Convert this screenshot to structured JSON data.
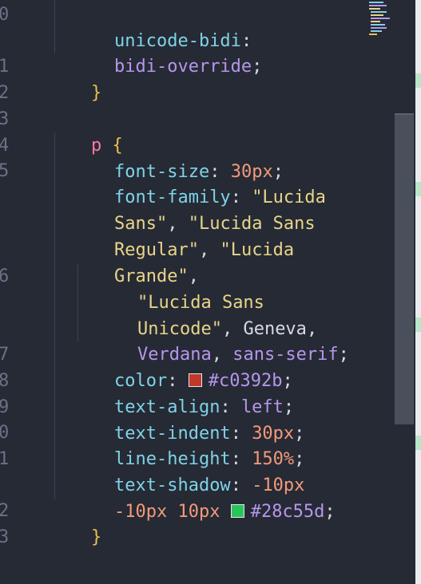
{
  "editor": {
    "gutter_numbers": [
      "0",
      "1",
      "2",
      "3",
      "4",
      "5",
      "6",
      "7",
      "8",
      "9",
      "0",
      "1",
      "2",
      "3"
    ],
    "colors": {
      "background": "#262a35",
      "property": "#7fd3e6",
      "string": "#e8d589",
      "keyword": "#b696ec",
      "number": "#f29a7a",
      "selector": "#f97b9d",
      "brace": "#e8c14a"
    },
    "code": {
      "l1_prop": "unicode-bidi",
      "l1_colon": ":",
      "l2_val": "bidi-override",
      "l2_semi": ";",
      "l3_brace": "}",
      "l5_sel": "p",
      "l5_brace": "{",
      "l6_prop": "font-size",
      "l6_colon": ": ",
      "l6_num": "30px",
      "l6_semi": ";",
      "l7_prop": "font-family",
      "l7_colon": ": ",
      "l7_str": "\"Lucida",
      "l8_str1": "Sans\"",
      "l8_comma": ", ",
      "l8_str2": "\"Lucida Sans",
      "l9_str1": "Regular\"",
      "l9_comma": ", ",
      "l9_str2": "\"Lucida",
      "l10_str": "Grande\"",
      "l10_comma": ",",
      "l11_str": "\"Lucida Sans",
      "l12_str": "Unicode\"",
      "l12_comma": ", ",
      "l12_val": "Geneva",
      "l12_comma2": ",",
      "l13_val1": "Verdana",
      "l13_comma": ", ",
      "l13_val2": "sans-serif",
      "l13_semi": ";",
      "l14_prop": "color",
      "l14_colon": ": ",
      "l14_swatch": "#c0392b",
      "l14_val": "#c0392b",
      "l14_semi": ";",
      "l15_prop": "text-align",
      "l15_colon": ": ",
      "l15_val": "left",
      "l15_semi": ";",
      "l16_prop": "text-indent",
      "l16_colon": ": ",
      "l16_num": "30px",
      "l16_semi": ";",
      "l17_prop": "line-height",
      "l17_colon": ": ",
      "l17_num": "150%",
      "l17_semi": ";",
      "l18_prop": "text-shadow",
      "l18_colon": ": ",
      "l18_num": "-10px",
      "l19_num1": "-10px",
      "l19_sp": " ",
      "l19_num2": "10px",
      "l19_swatch": "#28c55d",
      "l19_val": "#28c55d",
      "l19_semi": ";",
      "l20_brace": "}"
    }
  }
}
